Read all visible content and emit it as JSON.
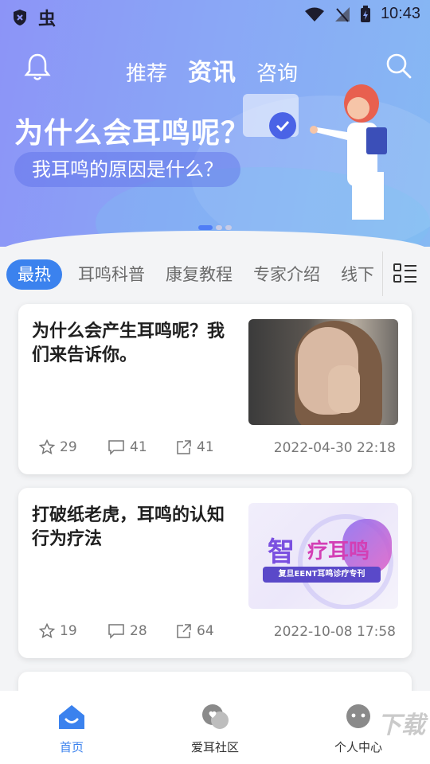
{
  "status_bar": {
    "time": "10:43",
    "left_badge": "虫"
  },
  "header": {
    "tabs": [
      {
        "label": "推荐",
        "active": false
      },
      {
        "label": "资讯",
        "active": true
      },
      {
        "label": "咨询",
        "active": false
      }
    ]
  },
  "banner": {
    "title": "为什么会耳鸣呢？",
    "subtitle": "我耳鸣的原因是什么？",
    "page_count": 3,
    "active_page": 1
  },
  "categories": [
    {
      "label": "最热",
      "active": true
    },
    {
      "label": "耳鸣科普",
      "active": false
    },
    {
      "label": "康复教程",
      "active": false
    },
    {
      "label": "专家介绍",
      "active": false
    },
    {
      "label": "线下",
      "active": false
    }
  ],
  "articles": [
    {
      "title": "为什么会产生耳鸣呢？我们来告诉你。",
      "likes": "29",
      "comments": "41",
      "shares": "41",
      "date": "2022-04-30 22:18"
    },
    {
      "title": "打破纸老虎，耳鸣的认知行为疗法",
      "likes": "19",
      "comments": "28",
      "shares": "64",
      "date": "2022-10-08 17:58",
      "thumb_text": {
        "zhi": "智",
        "big": "疗耳鸣",
        "banner": "复旦EENT耳鸣诊疗专刊"
      }
    }
  ],
  "bottom_nav": [
    {
      "label": "首页",
      "icon": "home-icon",
      "active": true
    },
    {
      "label": "爱耳社区",
      "icon": "community-icon",
      "active": false
    },
    {
      "label": "个人中心",
      "icon": "profile-icon",
      "active": false
    }
  ],
  "watermark": "下载",
  "colors": {
    "accent": "#3b82ee",
    "hero_start": "#8c94f7",
    "hero_end": "#86b9f3"
  }
}
